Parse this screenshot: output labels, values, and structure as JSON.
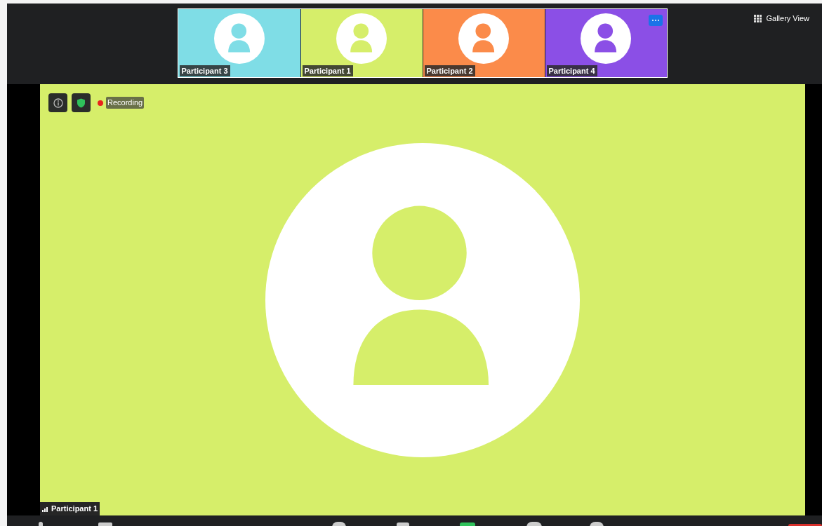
{
  "thumbnails": [
    {
      "name": "Participant 3",
      "color": "#7fdde6",
      "menu": false
    },
    {
      "name": "Participant 1",
      "color": "#d6ee6a",
      "menu": false
    },
    {
      "name": "Participant 2",
      "color": "#fb8b4a",
      "menu": false
    },
    {
      "name": "Participant 4",
      "color": "#8b4fe6",
      "menu": true
    }
  ],
  "view_button": {
    "label": "Gallery View"
  },
  "main_video": {
    "name": "Participant 1",
    "color": "#d6ee6a",
    "recording_label": "Recording"
  }
}
